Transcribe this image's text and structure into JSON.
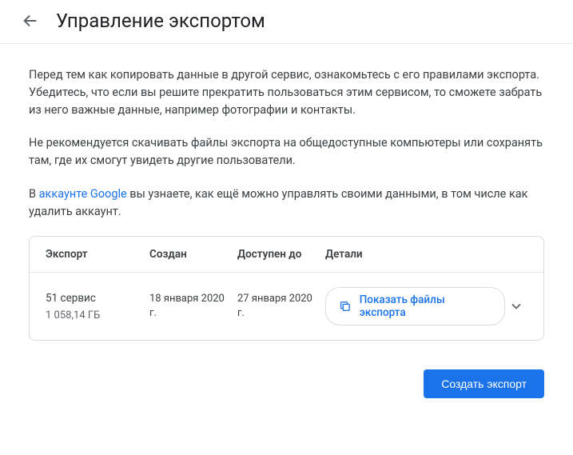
{
  "header": {
    "title": "Управление экспортом"
  },
  "intro": {
    "p1": "Перед тем как копировать данные в другой сервис, ознакомьтесь с его правилами экспорта. Убедитесь, что если вы решите прекратить пользоваться этим сервисом, то сможете забрать из него важные данные, например фотографии и контакты.",
    "p2": "Не рекомендуется скачивать файлы экспорта на общедоступные компьютеры или сохранять там, где их смогут увидеть другие пользователи.",
    "p3_prefix": "В ",
    "p3_link": "аккаунте Google",
    "p3_suffix": " вы узнаете, как ещё можно управлять своими данными, в том числе как удалить аккаунт."
  },
  "table": {
    "headers": {
      "export": "Экспорт",
      "created": "Создан",
      "available": "Доступен до",
      "details": "Детали"
    },
    "row": {
      "service_count": "51 сервис",
      "size": "1 058,14 ГБ",
      "created": "18 января 2020 г.",
      "available_until": "27 января 2020 г.",
      "show_files": "Показать файлы экспорта"
    }
  },
  "footer": {
    "create_export": "Создать экспорт"
  }
}
